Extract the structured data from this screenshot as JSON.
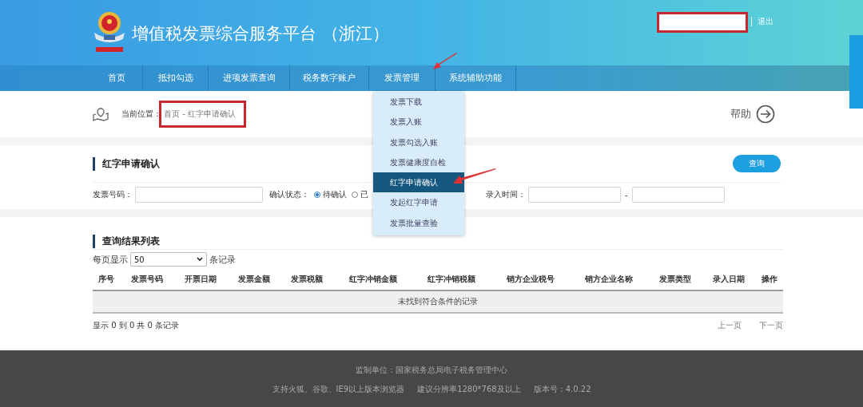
{
  "header": {
    "title": "增值税发票综合服务平台 （浙江）",
    "logout": "退出"
  },
  "nav": {
    "items": [
      {
        "label": "首页"
      },
      {
        "label": "抵扣勾选"
      },
      {
        "label": "进项发票查询"
      },
      {
        "label": "税务数字账户"
      },
      {
        "label": "发票管理"
      },
      {
        "label": "系统辅助功能"
      }
    ]
  },
  "dropdown": {
    "items": [
      {
        "label": "发票下载",
        "selected": false
      },
      {
        "label": "发票入账",
        "selected": false
      },
      {
        "label": "发票勾选入账",
        "selected": false
      },
      {
        "label": "发票健康度自检",
        "selected": false
      },
      {
        "label": "红字申请确认",
        "selected": true
      },
      {
        "label": "发起红字申请",
        "selected": false
      },
      {
        "label": "发票批量查验",
        "selected": false
      }
    ]
  },
  "breadcrumb": {
    "label": "当前位置：",
    "path": "首页 - 红字申请确认",
    "help": "帮助"
  },
  "query": {
    "title": "红字申请确认",
    "button": "查询",
    "invoice_no_label": "发票号码：",
    "status_label": "确认状态：",
    "status_options": [
      {
        "label": "待确认",
        "checked": true
      },
      {
        "label": "已",
        "checked": false
      }
    ],
    "entry_time_label": "录入时间：",
    "range_separator": "-"
  },
  "results": {
    "title": "查询结果列表",
    "page_size_prefix": "每页显示",
    "page_size": "50",
    "page_size_suffix": "条记录",
    "columns": [
      "序号",
      "发票号码",
      "开票日期",
      "发票金额",
      "发票税额",
      "红字冲销金额",
      "红字冲销税额",
      "销方企业税号",
      "销方企业名称",
      "发票类型",
      "录入日期",
      "操作"
    ],
    "empty_message": "未找到符合条件的记录",
    "summary": "显示 0 到 0 共 0 条记录",
    "prev": "上一页",
    "next": "下一页"
  },
  "footer": {
    "line_1": "监制单位：国家税务总局电子税务管理中心",
    "line_2": [
      "支持火狐、谷歌、IE9以上版本浏览器",
      "建议分辨率1280*768及以上",
      "版本号：4.0.22"
    ]
  }
}
